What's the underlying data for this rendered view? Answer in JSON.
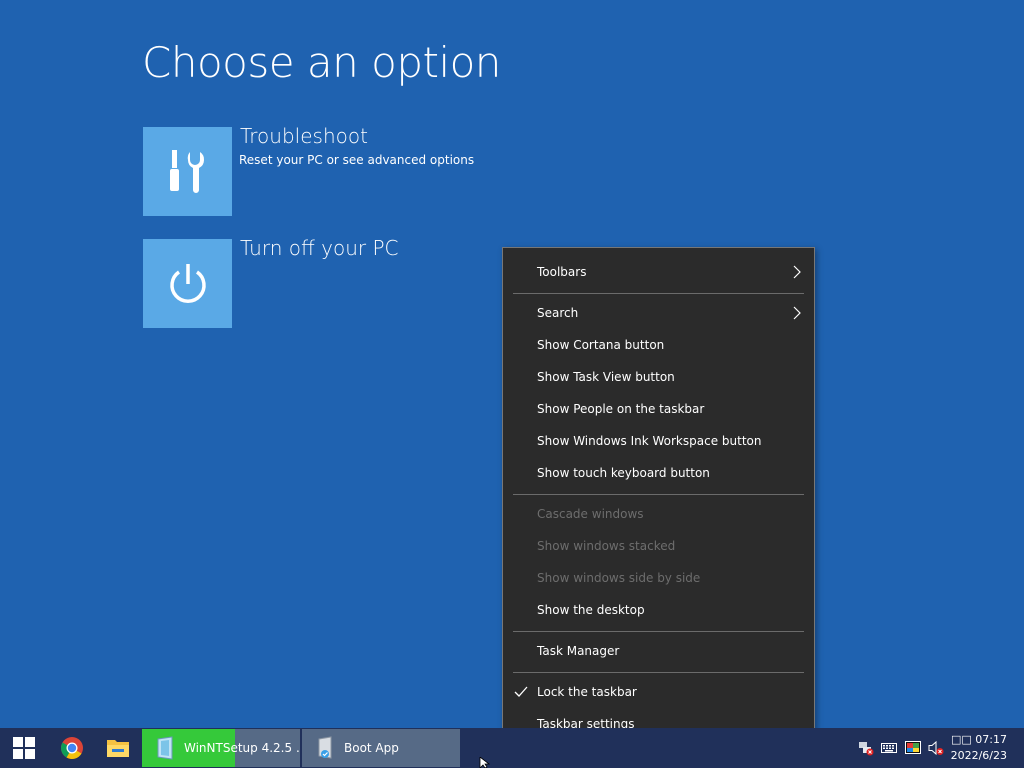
{
  "screen": {
    "title": "Choose an option",
    "options": [
      {
        "title": "Troubleshoot",
        "description": "Reset your PC or see advanced options",
        "icon": "tools-icon"
      },
      {
        "title": "Turn off your PC",
        "description": "",
        "icon": "power-icon"
      }
    ]
  },
  "context_menu": {
    "items": [
      {
        "label": "Toolbars",
        "submenu": true
      },
      {
        "label": "Search",
        "submenu": true
      },
      {
        "label": "Show Cortana button"
      },
      {
        "label": "Show Task View button"
      },
      {
        "label": "Show People on the taskbar"
      },
      {
        "label": "Show Windows Ink Workspace button"
      },
      {
        "label": "Show touch keyboard button"
      },
      {
        "label": "Cascade windows",
        "disabled": true
      },
      {
        "label": "Show windows stacked",
        "disabled": true
      },
      {
        "label": "Show windows side by side",
        "disabled": true
      },
      {
        "label": "Show the desktop"
      },
      {
        "label": "Task Manager"
      },
      {
        "label": "Lock the taskbar",
        "checked": true
      },
      {
        "label": "Taskbar settings"
      }
    ]
  },
  "taskbar": {
    "apps": [
      {
        "label": "WinNTSetup 4.2.5   ...",
        "progress": 0.59
      },
      {
        "label": "Boot App"
      }
    ],
    "clock": {
      "time": "□□ 07:17",
      "date": "2022/6/23"
    }
  },
  "colors": {
    "background": "#1f62b0",
    "tile": "#5aa9e6",
    "menu_bg": "#2b2b2b",
    "taskbar": "#20305a",
    "progress": "#35c93a"
  }
}
